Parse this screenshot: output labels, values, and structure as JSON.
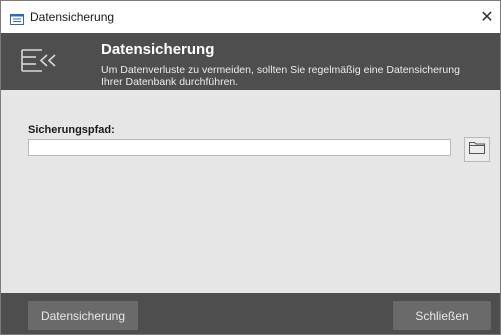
{
  "window": {
    "title": "Datensicherung",
    "close_glyph": "✕"
  },
  "banner": {
    "title": "Datensicherung",
    "description": "Um Datenverluste zu vermeiden, sollten Sie regelmäßig eine Datensicherung Ihrer Datenbank durchführen.",
    "icon": "list-collapse-icon"
  },
  "form": {
    "path_label": "Sicherungspfad:",
    "path_value": "",
    "browse_icon": "folder-icon"
  },
  "footer": {
    "backup_label": "Datensicherung",
    "close_label": "Schließen"
  },
  "colors": {
    "banner_bg": "#4e4e4e",
    "body_bg": "#e6e6e6",
    "button_bg": "#6a6a6a"
  }
}
